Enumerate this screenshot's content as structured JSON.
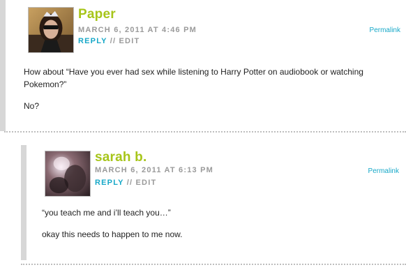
{
  "comments": [
    {
      "author": "Paper",
      "date": "MARCH 6, 2011 AT 4:46 PM",
      "reply_label": "REPLY",
      "separator": "//",
      "edit_label": "EDIT",
      "permalink_label": "Permalink",
      "paragraphs": [
        "How about “Have you ever had sex while listening to Harry Potter on audiobook or watching Pokemon?”",
        "No?"
      ],
      "avatar_icon": "user-photo-girl-tiara"
    },
    {
      "author": "sarah b.",
      "date": "MARCH 6, 2011 AT 6:13 PM",
      "reply_label": "REPLY",
      "separator": "//",
      "edit_label": "EDIT",
      "permalink_label": "Permalink",
      "paragraphs": [
        "“you teach me and i’ll teach you…”",
        "okay this needs to happen to me now."
      ],
      "avatar_icon": "user-photo-blurry"
    }
  ],
  "colors": {
    "author": "#a7c51a",
    "link": "#17a8c8",
    "meta": "#9a9a9a",
    "border": "#d7d7d7"
  }
}
